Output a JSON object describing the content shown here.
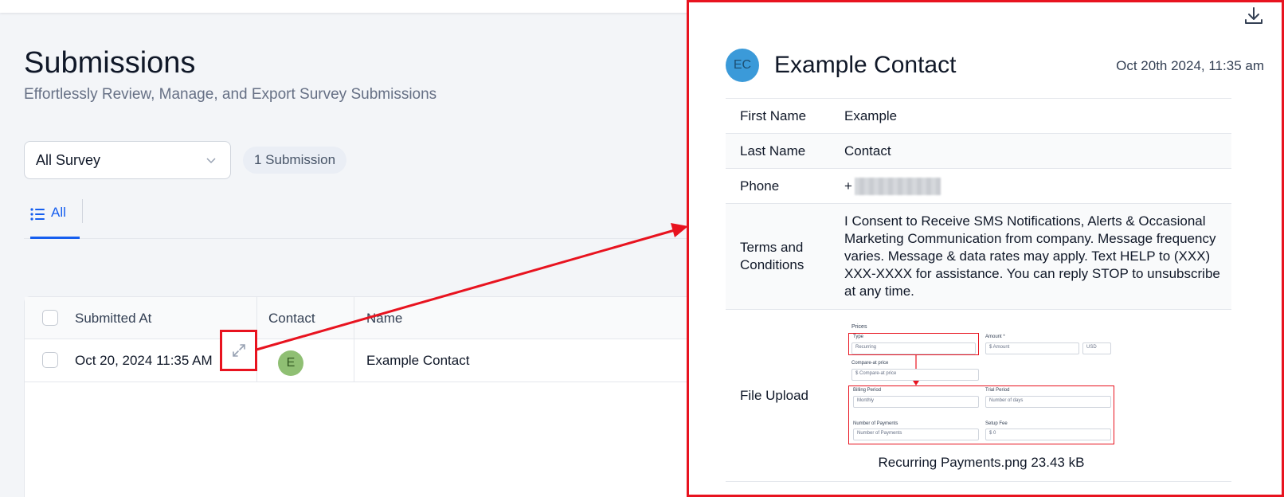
{
  "page": {
    "title": "Submissions",
    "subtitle": "Effortlessly Review, Manage, and Export Survey Submissions"
  },
  "filters": {
    "survey_select": "All Survey",
    "submission_count": "1 Submission"
  },
  "tabs": [
    {
      "label": "All"
    }
  ],
  "table": {
    "columns": [
      "Submitted At",
      "Contact",
      "Name"
    ],
    "rows": [
      {
        "submitted_at": "Oct 20, 2024 11:35 AM",
        "contact_initial": "E",
        "name": "Example Contact"
      }
    ]
  },
  "panel": {
    "avatar_initials": "EC",
    "contact_name": "Example Contact",
    "date": "Oct 20th 2024, 11:35 am",
    "fields": [
      {
        "label": "First Name",
        "value": "Example"
      },
      {
        "label": "Last Name",
        "value": "Contact"
      },
      {
        "label": "Phone",
        "value": "+"
      },
      {
        "label": "Terms and Conditions",
        "value": "I Consent to Receive SMS Notifications, Alerts & Occasional Marketing Communication from company. Message frequency varies. Message & data rates may apply. Text HELP to (XXX) XXX-XXXX for assistance. You can reply STOP to unsubscribe at any time."
      },
      {
        "label": "File Upload",
        "value": "Recurring Payments.png 23.43 kB"
      }
    ],
    "file_preview": {
      "heading": "Prices",
      "type_label": "Type",
      "type_value": "Recurring",
      "amount_label": "Amount *",
      "amount_placeholder": "$ Amount",
      "currency": "USD",
      "compare_label": "Compare-at price",
      "compare_placeholder": "$ Compare-at price",
      "billing_label": "Billing Period",
      "billing_value": "Monthly",
      "trial_label": "Trial Period",
      "trial_placeholder": "Number of days",
      "payments_label": "Number of Payments",
      "payments_placeholder": "Number of Payments",
      "setup_label": "Setup Fee",
      "setup_placeholder": "$ 0"
    }
  },
  "colors": {
    "accent": "#155eef",
    "highlight": "#e8131f",
    "avatar_e": "#8fbf73",
    "avatar_ec": "#3b9ad9"
  }
}
